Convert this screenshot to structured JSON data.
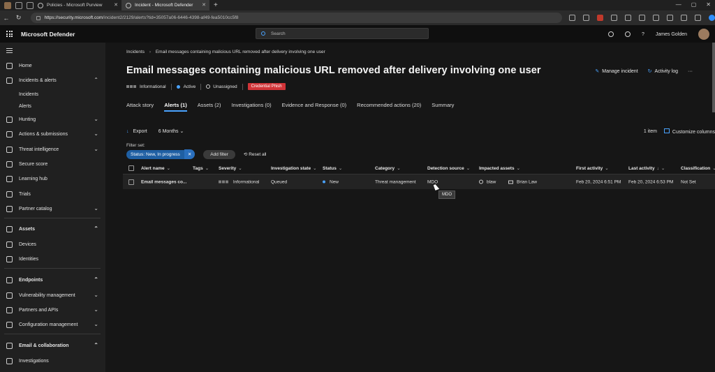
{
  "browser": {
    "tabs": [
      {
        "label": "Policies - Microsoft Purview",
        "active": false
      },
      {
        "label": "Incident - Microsoft Defender",
        "active": true
      }
    ],
    "new_tab": "+",
    "url_host": "https://security.microsoft.com",
    "url_path": "/incident2/2129/alerts?tid=35057a06-6446-4398-af49-fea5010cc5f8",
    "window_controls": [
      "—",
      "▢",
      "✕"
    ]
  },
  "header": {
    "app_title": "Microsoft Defender",
    "search_placeholder": "Search",
    "user_name": "James Golden"
  },
  "leftnav": {
    "items": [
      {
        "label": "Home",
        "icon": "home-icon"
      },
      {
        "label": "Incidents & alerts",
        "icon": "shield-icon",
        "chevron": "^"
      },
      {
        "label": "Incidents",
        "sub": true
      },
      {
        "label": "Alerts",
        "sub": true
      },
      {
        "label": "Hunting",
        "icon": "hunting-icon",
        "chevron": "v"
      },
      {
        "label": "Actions & submissions",
        "icon": "actions-icon",
        "chevron": "v"
      },
      {
        "label": "Threat intelligence",
        "icon": "threat-icon",
        "chevron": "v"
      },
      {
        "label": "Secure score",
        "icon": "trophy-icon"
      },
      {
        "label": "Learning hub",
        "icon": "learning-icon"
      },
      {
        "label": "Trials",
        "icon": "trials-icon"
      },
      {
        "label": "Partner catalog",
        "icon": "catalog-icon",
        "chevron": "v"
      },
      {
        "label": "Assets",
        "icon": "assets-icon",
        "chevron": "^",
        "bold": true
      },
      {
        "label": "Devices",
        "icon": "device-icon"
      },
      {
        "label": "Identities",
        "icon": "identity-icon"
      },
      {
        "label": "Endpoints",
        "icon": "endpoints-icon",
        "chevron": "^",
        "bold": true
      },
      {
        "label": "Vulnerability management",
        "icon": "vuln-icon",
        "chevron": "v"
      },
      {
        "label": "Partners and APIs",
        "icon": "partners-icon",
        "chevron": "v"
      },
      {
        "label": "Configuration management",
        "icon": "config-icon",
        "chevron": "v"
      },
      {
        "label": "Email & collaboration",
        "icon": "mail-icon",
        "chevron": "^",
        "bold": true
      },
      {
        "label": "Investigations",
        "icon": "investigations-icon"
      }
    ]
  },
  "incident": {
    "breadcrumb_root": "Incidents",
    "breadcrumb_current": "Email messages containing malicious URL removed after delivery involving one user",
    "title": "Email messages containing malicious URL removed after delivery involving one user",
    "manage_label": "Manage incident",
    "activity_label": "Activity log",
    "more_label": "···",
    "severity": "Informational",
    "status": "Active",
    "assignee": "Unassigned",
    "tag": "Credential Phish"
  },
  "tabs": [
    "Attack story",
    "Alerts (1)",
    "Assets (2)",
    "Investigations (0)",
    "Evidence and Response (0)",
    "Recommended actions (20)",
    "Summary"
  ],
  "toolbar": {
    "export_label": "Export",
    "range_label": "6 Months",
    "count_label": "1 item",
    "customize_label": "Customize columns"
  },
  "filters": {
    "label": "Filter set:",
    "chip": "Status: New, In progress",
    "add_label": "Add filter",
    "reset_label": "Reset all"
  },
  "columns": [
    "Alert name",
    "Tags",
    "Severity",
    "Investigation state",
    "Status",
    "Category",
    "Detection source",
    "Impacted assets",
    "First activity",
    "Last activity",
    "Classification"
  ],
  "rows": [
    {
      "alert_name": "Email messages co...",
      "severity": "Informational",
      "investigation_state": "Queued",
      "status": "New",
      "category": "Threat management",
      "detection_source": "MDO",
      "asset_user": "blaw",
      "asset_device": "Brian Law",
      "first_activity": "Feb 20, 2024 6:51 PM",
      "last_activity": "Feb 20, 2024 6:53 PM",
      "classification": "Not Set"
    }
  ],
  "tooltip": "MDO",
  "colors": {
    "accent": "#4aa3ff",
    "tag_red": "#d13438",
    "background": "#161616"
  }
}
